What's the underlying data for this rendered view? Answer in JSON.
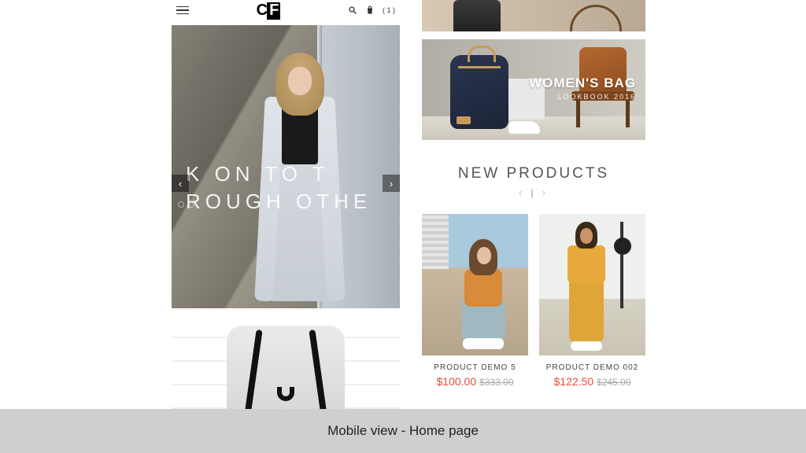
{
  "header": {
    "logo_left": "C",
    "logo_right": "F",
    "cart_count": "( 1 )"
  },
  "hero": {
    "line1": "K ON      TO T",
    "line2": "ROUGH     OTHE"
  },
  "promo_bag": {
    "title": "WOMEN'S BAG",
    "subtitle": "LOOKBOOK 2016"
  },
  "section": {
    "title": "NEW PRODUCTS"
  },
  "products": [
    {
      "name": "PRODUCT DEMO 5",
      "price": "$100.00",
      "old": "$333.00"
    },
    {
      "name": "PRODUCT DEMO 002",
      "price": "$122.50",
      "old": "$245.00"
    }
  ],
  "caption": "Mobile view - Home page"
}
